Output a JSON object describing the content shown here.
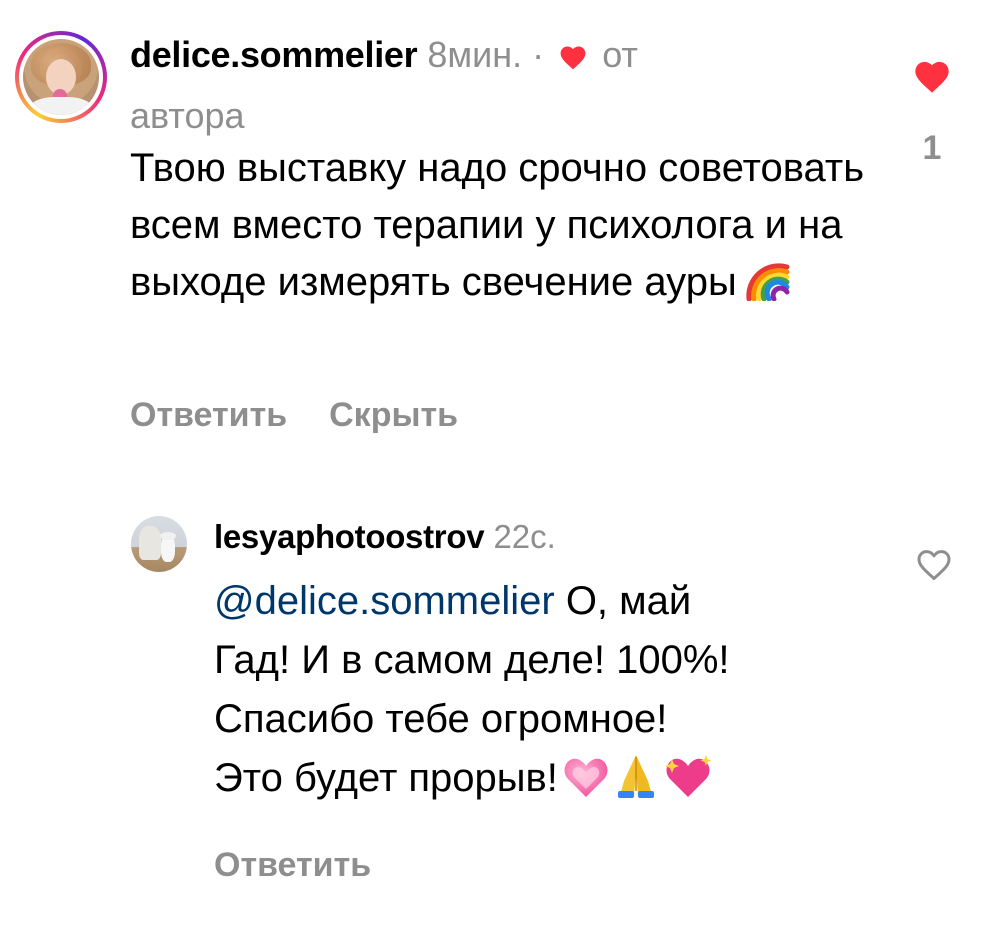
{
  "comment": {
    "username": "delice.sommelier",
    "time": "8мин.",
    "separator": "·",
    "liked_by_author_prefix": "от",
    "liked_by_author_suffix": "автора",
    "text": "Твою выставку надо срочно советовать всем вместо терапии у психолога и на выходе измерять свечение ауры",
    "emoji": "rainbow",
    "reply_label": "Ответить",
    "hide_label": "Скрыть",
    "like_count": "1",
    "liked": true,
    "heart_color": "#ff3040"
  },
  "reply": {
    "username": "lesyaphotoostrov",
    "time": "22с.",
    "mention": "@delice.sommelier",
    "text_line1_after_mention": " О, май",
    "text_line2": "Гад! И в самом деле! 100%!",
    "text_line3": "Спасибо тебе огромное!",
    "text_line4": "Это будет прорыв!",
    "emojis": [
      "heart-with-ribbon",
      "folded-hands",
      "sparkling-heart"
    ],
    "reply_label": "Ответить",
    "liked": false
  },
  "colors": {
    "secondary_text": "#8e8e8e",
    "mention": "#00376b",
    "like_red": "#ff3040"
  }
}
